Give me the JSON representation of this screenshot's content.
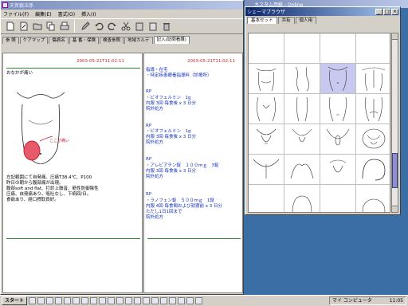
{
  "main_window": {
    "title": "天賀鍛法係",
    "menu": [
      "ファイル(F)",
      "編集(E)",
      "書式(O)",
      "挿入(I)"
    ],
    "tabs": [
      "参 照",
      "ケアマップ",
      "傷病名",
      "基 番・保険",
      "検査参照",
      "地域カルテ",
      "記入(訪問看護)"
    ],
    "left_note": {
      "date": "2003-05-21T11:02:11",
      "complaint": "おなかが痛い",
      "label": "ここが痛い",
      "findings": "左記範囲にて自発痛、圧痛T38.4℃、P100\n昨日の朝から腹部痛が出現。\n腹部soft and flat、打診上鼓音、筋性防御陰性\n圧痛、自発痛あり。嘔吐なし、下痢回/日。\n食欲あり、経口摂取良好。"
    },
    "right_note": {
      "date": "2003-05-21T11:02:11",
      "header": "指導・在宅\n・特定疾患療養指導料（診療所）",
      "rx": [
        {
          "rp": "RP",
          "lines": "・ビオフェルミン　1g\n内服 3回 毎食後 x 3 日分\n院外処方"
        },
        {
          "rp": "RP",
          "lines": "・ビオフェルミン　1g\n内服 3回 毎食後 x 3 日分\n院外処方"
        },
        {
          "rp": "RP",
          "lines": "・アレビアチン錠　１００ｍｇ　3錠\n内服 3回 毎食後 x 3 日分\n院外処方"
        },
        {
          "rp": "RP",
          "lines": "・ラノフェン錠　５００ｍｇ　1錠\n内服 4回 毎食間および就寝前 x 3 日分\nただし1日1回まで\n院外処方"
        }
      ]
    }
  },
  "schema_window": {
    "title": "シェーマブラウザ",
    "tabs": [
      "基本セット",
      "共有",
      "個人用"
    ]
  },
  "background_window": {
    "title": "カスタム用紙 - Online"
  },
  "taskbar": {
    "start_label": "スタート",
    "tray_text": "マイ コンピュータ",
    "clock": "11:05"
  },
  "colors": {
    "accent": "#0a246a",
    "date_red": "#c03030",
    "rx_blue": "#1030c0"
  }
}
